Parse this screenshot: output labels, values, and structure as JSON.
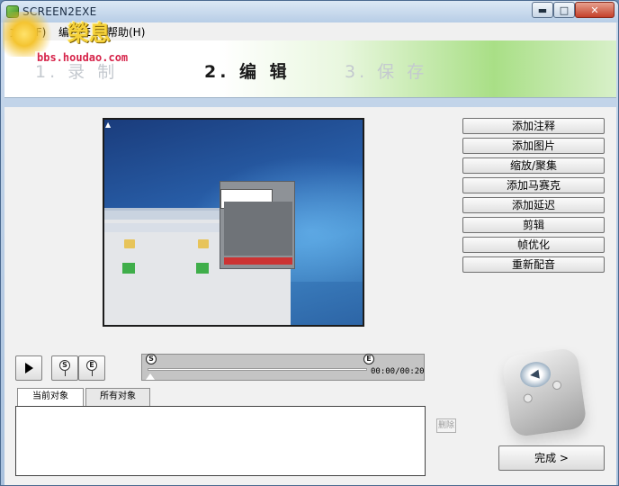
{
  "window": {
    "title": "SCREEN2EXE",
    "controls": {
      "minimize": "▬",
      "maximize": "□",
      "close": "✕"
    }
  },
  "logo": {
    "glyph": "榮息",
    "url": "bbs.houdao.com"
  },
  "menu": [
    {
      "label": "文件(F)"
    },
    {
      "label": "编辑(E)"
    },
    {
      "label": "帮助(H)"
    }
  ],
  "steps": [
    {
      "label": "1. 录 制",
      "state": "inactive"
    },
    {
      "label": "2. 编 辑",
      "state": "active"
    },
    {
      "label": "3. 保 存",
      "state": "inactive"
    }
  ],
  "actions": [
    {
      "label": "添加注释"
    },
    {
      "label": "添加图片"
    },
    {
      "label": "缩放/聚集"
    },
    {
      "label": "添加马赛克"
    },
    {
      "label": "添加延迟"
    },
    {
      "label": "剪辑"
    },
    {
      "label": "帧优化"
    },
    {
      "label": "重新配音"
    }
  ],
  "playback": {
    "start_marker": "S",
    "end_marker": "E"
  },
  "timeline": {
    "time": "00:00/00:20",
    "start_marker": "S",
    "end_marker": "E"
  },
  "tabs": [
    {
      "label": "当前对象",
      "active": true
    },
    {
      "label": "所有对象",
      "active": false
    }
  ],
  "delete_label": "删除",
  "finish_label": "完成 >",
  "colors": {
    "banner_accent": "#a9df86",
    "title_bar": "#b7cde6",
    "close_button": "#c4402a"
  }
}
